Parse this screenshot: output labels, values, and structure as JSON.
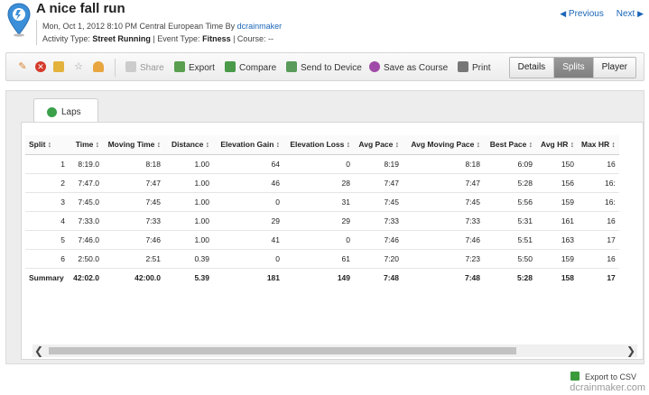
{
  "header": {
    "title": "A nice fall run",
    "date_line": "Mon, Oct 1, 2012 8:10 PM Central European Time By ",
    "author": "dcrainmaker",
    "activity_label": "Activity Type: ",
    "activity_type": "Street Running",
    "event_label": " | Event Type: ",
    "event_type": "Fitness",
    "course_label": " | Course: --",
    "previous": "Previous",
    "next": "Next"
  },
  "toolbar": {
    "share": "Share",
    "export": "Export",
    "compare": "Compare",
    "send": "Send to Device",
    "save_course": "Save as Course",
    "print": "Print",
    "views": [
      "Details",
      "Splits",
      "Player"
    ],
    "active_view": "Splits"
  },
  "tabs": {
    "laps": "Laps"
  },
  "table": {
    "columns": [
      "Split ↕",
      "Time ↕",
      "Moving Time ↕",
      "Distance ↕",
      "Elevation Gain ↕",
      "Elevation Loss ↕",
      "Avg Pace ↕",
      "Avg Moving Pace ↕",
      "Best Pace ↕",
      "Avg HR ↕",
      "Max HR ↕"
    ],
    "rows": [
      [
        "1",
        "8:19.0",
        "8:18",
        "1.00",
        "64",
        "0",
        "8:19",
        "8:18",
        "6:09",
        "150",
        "16"
      ],
      [
        "2",
        "7:47.0",
        "7:47",
        "1.00",
        "46",
        "28",
        "7:47",
        "7:47",
        "5:28",
        "156",
        "16:"
      ],
      [
        "3",
        "7:45.0",
        "7:45",
        "1.00",
        "0",
        "31",
        "7:45",
        "7:45",
        "5:56",
        "159",
        "16:"
      ],
      [
        "4",
        "7:33.0",
        "7:33",
        "1.00",
        "29",
        "29",
        "7:33",
        "7:33",
        "5:31",
        "161",
        "16"
      ],
      [
        "5",
        "7:46.0",
        "7:46",
        "1.00",
        "41",
        "0",
        "7:46",
        "7:46",
        "5:51",
        "163",
        "17"
      ],
      [
        "6",
        "2:50.0",
        "2:51",
        "0.39",
        "0",
        "61",
        "7:20",
        "7:23",
        "5:50",
        "159",
        "16"
      ]
    ],
    "summary": [
      "Summary",
      "42:02.0",
      "42:00.0",
      "5.39",
      "181",
      "149",
      "7:48",
      "7:48",
      "5:28",
      "158",
      "17"
    ]
  },
  "footer": {
    "export_csv": "Export to CSV",
    "watermark": "dcrainmaker.com"
  },
  "colors": {
    "link": "#1a66b8",
    "active_segment": "#8a8a8a",
    "accent_green": "#3aa04a"
  },
  "icons": [
    "pin-icon",
    "edit-icon",
    "delete-icon",
    "lock-icon",
    "star-icon",
    "user-icon",
    "share-icon",
    "export-icon",
    "compare-icon",
    "send-icon",
    "course-icon",
    "print-icon",
    "laps-icon",
    "excel-icon"
  ]
}
